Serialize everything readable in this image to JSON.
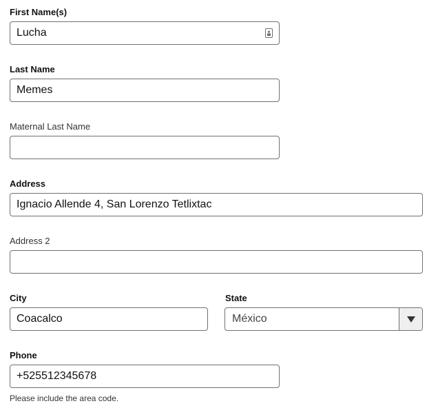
{
  "form": {
    "first_name": {
      "label": "First Name(s)",
      "value": "Lucha",
      "icon": "contact-card-icon"
    },
    "last_name": {
      "label": "Last Name",
      "value": "Memes"
    },
    "maternal_last_name": {
      "label": "Maternal Last Name",
      "value": ""
    },
    "address": {
      "label": "Address",
      "value": "Ignacio Allende 4, San Lorenzo Tetlixtac"
    },
    "address2": {
      "label": "Address 2",
      "value": ""
    },
    "city": {
      "label": "City",
      "value": "Coacalco"
    },
    "state": {
      "label": "State",
      "selected": "México",
      "icon": "triangle-down-icon"
    },
    "phone": {
      "label": "Phone",
      "value": "+525512345678",
      "help": "Please include the area code."
    }
  }
}
